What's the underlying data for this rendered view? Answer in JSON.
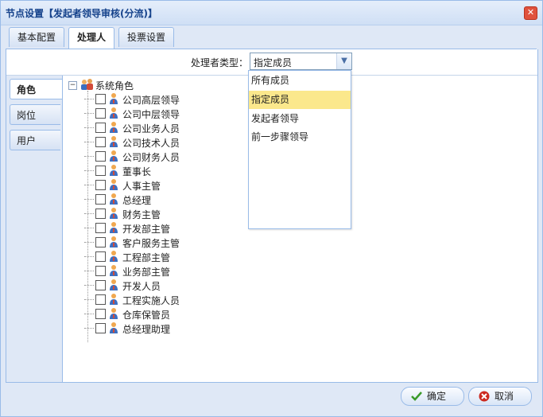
{
  "window": {
    "title": "节点设置【发起者领导审核(分流)】"
  },
  "tabs": [
    {
      "label": "基本配置"
    },
    {
      "label": "处理人"
    },
    {
      "label": "投票设置"
    }
  ],
  "handler": {
    "type_label": "处理者类型：",
    "type_value": "指定成员",
    "options": [
      "所有成员",
      "指定成员",
      "发起者领导",
      "前一步骤领导"
    ]
  },
  "side_tabs": [
    {
      "label": "角色"
    },
    {
      "label": "岗位"
    },
    {
      "label": "用户"
    }
  ],
  "tree": {
    "root_label": "系统角色",
    "items": [
      "公司高层领导",
      "公司中层领导",
      "公司业务人员",
      "公司技术人员",
      "公司财务人员",
      "董事长",
      "人事主管",
      "总经理",
      "财务主管",
      "开发部主管",
      "客户服务主管",
      "工程部主管",
      "业务部主管",
      "开发人员",
      "工程实施人员",
      "仓库保管员",
      "总经理助理"
    ]
  },
  "buttons": {
    "ok": "确定",
    "cancel": "取消"
  },
  "colors": {
    "accent": "#99bbe8",
    "title_text": "#15428b",
    "selected_option": "#fbe88c",
    "ok_icon": "#3a9a2a",
    "cancel_icon": "#cc2a20"
  }
}
